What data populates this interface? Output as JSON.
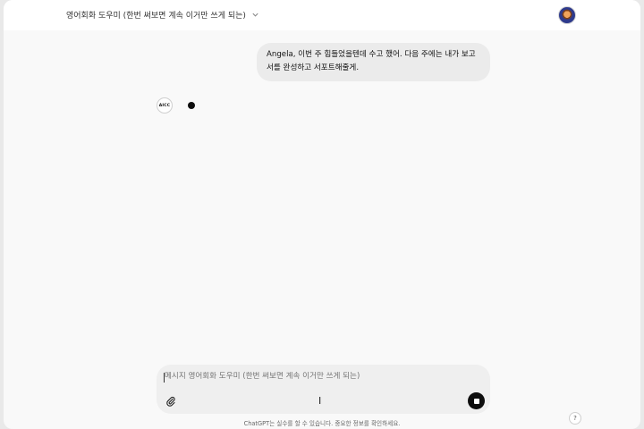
{
  "header": {
    "model_title": "영어회화 도우미 (한번 써보면 계속 이거만 쓰게 되는)",
    "dropdown_icon": "chevron-down-icon",
    "avatar_icon": "user-avatar"
  },
  "conversation": {
    "user_message": "Angela, 이번 주 힘들었을텐데 수고 했어. 다음 주에는 내가 보고서를 완성하고 서포트해줄게.",
    "assistant_avatar_text": "AICC",
    "assistant_status": "typing-indicator"
  },
  "composer": {
    "placeholder": "메시지 영어회화 도우미 (한번 써보면 계속 이거만 쓰게 되는)",
    "value": "",
    "attach_icon": "paperclip-icon",
    "stop_icon": "stop-icon"
  },
  "footer": {
    "disclaimer": "ChatGPT는 실수를 할 수 있습니다. 중요한 정보를 확인하세요.",
    "help_label": "?"
  },
  "colors": {
    "page_bg": "#f9f9f9",
    "bubble_bg": "#ebebeb",
    "composer_bg": "#efefef",
    "accent_dark": "#0d0d0d"
  }
}
